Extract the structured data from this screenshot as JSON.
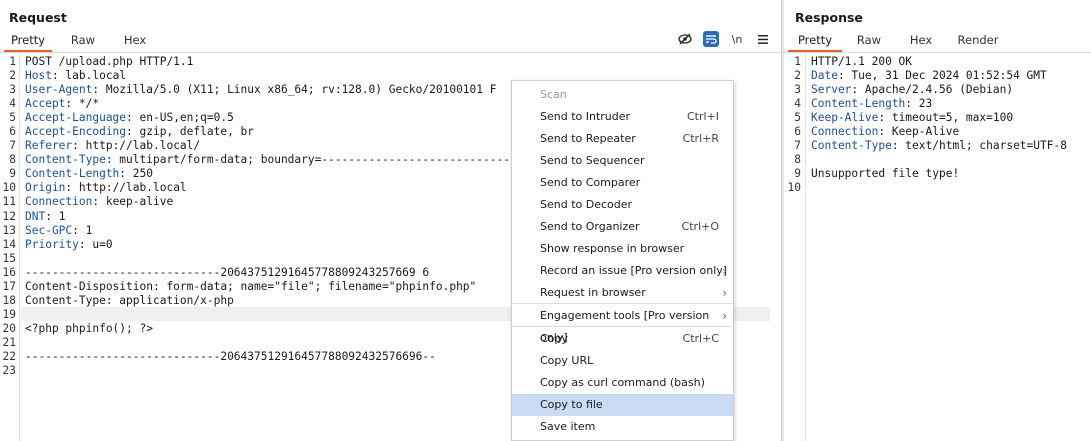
{
  "request": {
    "title": "Request",
    "tabs": [
      "Pretty",
      "Raw",
      "Hex"
    ],
    "active_tab": "Pretty",
    "toolbar_icons": [
      "eye-slash-icon",
      "wrap-icon",
      "newline-icon",
      "menu-icon"
    ],
    "newline_label": "\\n",
    "line_numbers": [
      "1",
      "2",
      "3",
      "4",
      "5",
      "6",
      "7",
      "8",
      "9",
      "10",
      "11",
      "12",
      "13",
      "14",
      "15",
      "16",
      "17",
      "18",
      "19",
      "20",
      "21",
      "22",
      "23"
    ],
    "lines": [
      {
        "key": "",
        "rest": "POST /upload.php HTTP/1.1"
      },
      {
        "key": "Host",
        "rest": ": lab.local"
      },
      {
        "key": "User-Agent",
        "rest": ": Mozilla/5.0 (X11; Linux x86_64; rv:128.0) Gecko/20100101 F"
      },
      {
        "key": "Accept",
        "rest": ": */*"
      },
      {
        "key": "Accept-Language",
        "rest": ": en-US,en;q=0.5"
      },
      {
        "key": "Accept-Encoding",
        "rest": ": gzip, deflate, br"
      },
      {
        "key": "Referer",
        "rest": ": http://lab.local/"
      },
      {
        "key": "Content-Type",
        "rest": ": multipart/form-data; boundary=----------------------------"
      },
      {
        "key": "Content-Length",
        "rest": ": 250"
      },
      {
        "key": "Origin",
        "rest": ": http://lab.local"
      },
      {
        "key": "Connection",
        "rest": ": keep-alive"
      },
      {
        "key": "DNT",
        "rest": ": 1"
      },
      {
        "key": "Sec-GPC",
        "rest": ": 1"
      },
      {
        "key": "Priority",
        "rest": ": u=0"
      },
      {
        "key": "",
        "rest": ""
      },
      {
        "key": "",
        "rest": "-----------------------------20643751291645778809243257669 6"
      },
      {
        "key": "",
        "rest": "Content-Disposition: form-data; name=\"file\"; filename=\"phpinfo.php\""
      },
      {
        "key": "",
        "rest": "Content-Type: application/x-php"
      },
      {
        "key": "",
        "rest": ""
      },
      {
        "key": "",
        "rest": "<?php phpinfo(); ?>"
      },
      {
        "key": "",
        "rest": ""
      },
      {
        "key": "",
        "rest": "-----------------------------206437512916457788092432576696--"
      },
      {
        "key": "",
        "rest": ""
      }
    ]
  },
  "response": {
    "title": "Response",
    "tabs": [
      "Pretty",
      "Raw",
      "Hex",
      "Render"
    ],
    "active_tab": "Pretty",
    "line_numbers": [
      "1",
      "2",
      "3",
      "4",
      "5",
      "6",
      "7",
      "8",
      "9",
      "10"
    ],
    "lines": [
      {
        "key": "",
        "rest": "HTTP/1.1 200 OK"
      },
      {
        "key": "Date",
        "rest": ": Tue, 31 Dec 2024 01:52:54 GMT"
      },
      {
        "key": "Server",
        "rest": ": Apache/2.4.56 (Debian)"
      },
      {
        "key": "Content-Length",
        "rest": ": 23"
      },
      {
        "key": "Keep-Alive",
        "rest": ": timeout=5, max=100"
      },
      {
        "key": "Connection",
        "rest": ": Keep-Alive"
      },
      {
        "key": "Content-Type",
        "rest": ": text/html; charset=UTF-8"
      },
      {
        "key": "",
        "rest": ""
      },
      {
        "key": "",
        "rest": "Unsupported file type!"
      },
      {
        "key": "",
        "rest": ""
      }
    ]
  },
  "context_menu": {
    "items": [
      {
        "label": "Scan",
        "shortcut": "",
        "disabled": true
      },
      {
        "label": "Send to Intruder",
        "shortcut": "Ctrl+I"
      },
      {
        "label": "Send to Repeater",
        "shortcut": "Ctrl+R"
      },
      {
        "label": "Send to Sequencer",
        "shortcut": ""
      },
      {
        "label": "Send to Comparer",
        "shortcut": ""
      },
      {
        "label": "Send to Decoder",
        "shortcut": ""
      },
      {
        "label": "Send to Organizer",
        "shortcut": "Ctrl+O"
      },
      {
        "label": "Show response in browser",
        "shortcut": ""
      },
      {
        "label": "Record an issue [Pro version only]",
        "submenu": true
      },
      {
        "label": "Request in browser",
        "submenu": true
      },
      {
        "label": "Engagement tools [Pro version only]",
        "submenu": true
      },
      {
        "label": "Copy",
        "shortcut": "Ctrl+C"
      },
      {
        "label": "Copy URL",
        "shortcut": ""
      },
      {
        "label": "Copy as curl command (bash)",
        "shortcut": ""
      },
      {
        "label": "Copy to file",
        "shortcut": "",
        "selected": true
      },
      {
        "label": "Save item",
        "shortcut": ""
      }
    ],
    "arrow_glyph": "›"
  },
  "colors": {
    "accent_tab": "#e8612c",
    "header_key": "#1f4fa3",
    "menu_selected": "#c9dcf3",
    "wrap_icon_active": "#2a6db4"
  }
}
